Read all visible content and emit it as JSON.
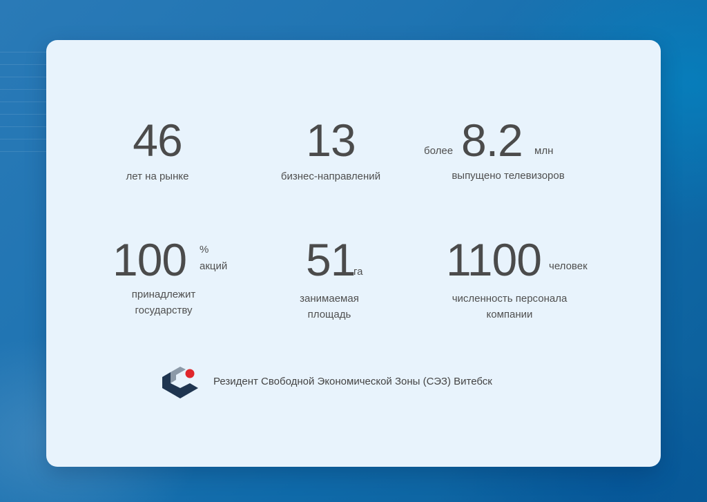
{
  "stats": {
    "years": {
      "value": "46",
      "label": "лет на рынке"
    },
    "business": {
      "value": "13",
      "label": "бизнес-направлений"
    },
    "tv": {
      "prefix": "более",
      "value": "8.2",
      "unit": "млн",
      "label": "выпущено телевизоров"
    },
    "shares": {
      "value": "100",
      "unit_top": "%",
      "unit_bottom": "акций",
      "label_line1": "принадлежит",
      "label_line2": "государству"
    },
    "area": {
      "value": "51",
      "unit": "га",
      "label_line1": "занимаемая",
      "label_line2": "площадь"
    },
    "staff": {
      "value": "1100",
      "unit": "человек",
      "label_line1": "численность персонала",
      "label_line2": "компании"
    }
  },
  "footer": {
    "text": "Резидент Свободной Экономической Зоны (СЭЗ) Витебск",
    "logo_icon": "sez-vitebsk-logo-icon"
  },
  "colors": {
    "card_bg": "#e8f3fc",
    "text": "#4b4b4b",
    "logo_dark": "#1f3550",
    "logo_red": "#e0262b"
  }
}
